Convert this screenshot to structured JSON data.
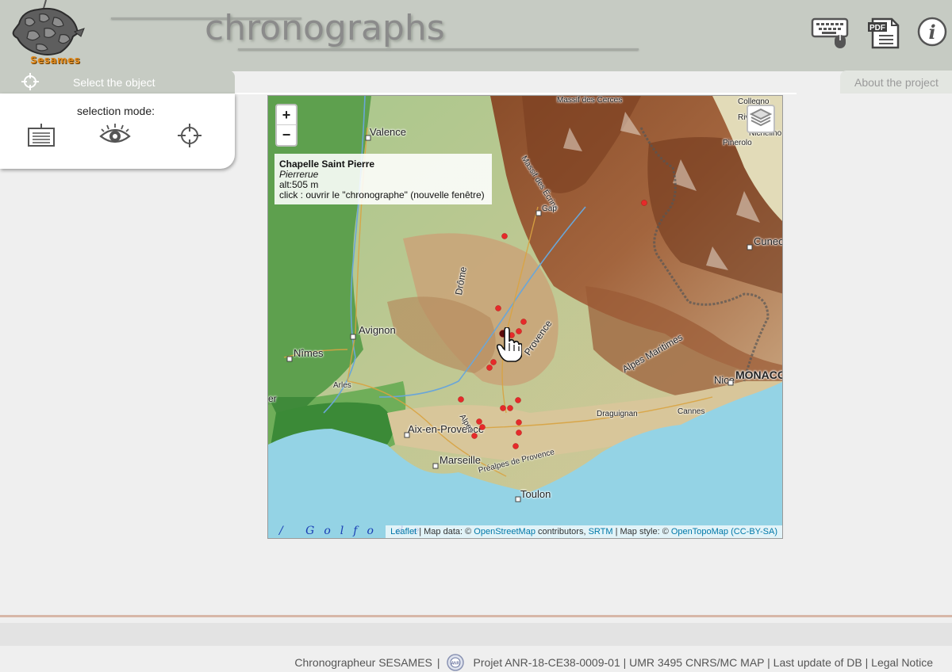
{
  "header": {
    "logo_text": "Sesames",
    "title": "chronographs",
    "icons": [
      "keyboard-mouse-icon",
      "pdf-icon",
      "info-icon"
    ],
    "pdf_label": "PDF",
    "info_label": "i"
  },
  "tabs": {
    "select_label": "Select the object",
    "about_label": "About the project"
  },
  "selection": {
    "label": "selection mode:",
    "modes": [
      "list-icon",
      "eye-icon",
      "crosshair-icon"
    ]
  },
  "map": {
    "zoom_in": "+",
    "zoom_out": "−",
    "popup": {
      "name": "Chapelle Saint Pierre",
      "commune": "Pierrerue",
      "altitude": "alt:505 m",
      "action": "click : ouvrir le \"chronographe\" (nouvelle fenêtre)"
    },
    "labels": {
      "massif": "Massif des Cerces",
      "collegno": "Collegno",
      "riv": "Riv",
      "nichelino": "Nichelino",
      "pinerolo": "Pinerolo",
      "valence": "Valence",
      "massif_ecrins": "Massif des Écrins",
      "gap": "Gap",
      "cuneo": "Cuneo",
      "drome": "Drôme",
      "avignon": "Avignon",
      "nimes": "Nîmes",
      "arles": "Arles",
      "provence": "Provence",
      "alpes_maritimes": "Alpes Maritimes",
      "monaco": "MONACO",
      "nice": "Nice",
      "draguignan": "Draguignan",
      "cannes": "Cannes",
      "aix": "Aix-en-Provence",
      "marseille": "Marseille",
      "prealpes": "Préalpes de Provence",
      "toulon": "Toulon",
      "alpes": "Alpes",
      "er": "er",
      "golfo": "/ Golfo de"
    },
    "attribution": {
      "leaflet": "Leaflet",
      "t1": " | Map data: © ",
      "osm": "OpenStreetMap",
      "t2": " contributors, ",
      "srtm": "SRTM",
      "t3": " | Map style: © ",
      "otm": "OpenTopoMap",
      "license": "(CC-BY-SA)"
    }
  },
  "footer": {
    "item1": "Chronographeur SESAMES",
    "sep": "|",
    "anr_logo": "ANR",
    "item2": "Projet ANR-18-CE38-0009-01 | UMR 3495 CNRS/MC MAP | Last update of DB | Legal Notice"
  },
  "colors": {
    "header_bg": "#c6cbc3",
    "marker": "#e62a2a",
    "sea": "#94d3e5",
    "link": "#0078a8"
  }
}
